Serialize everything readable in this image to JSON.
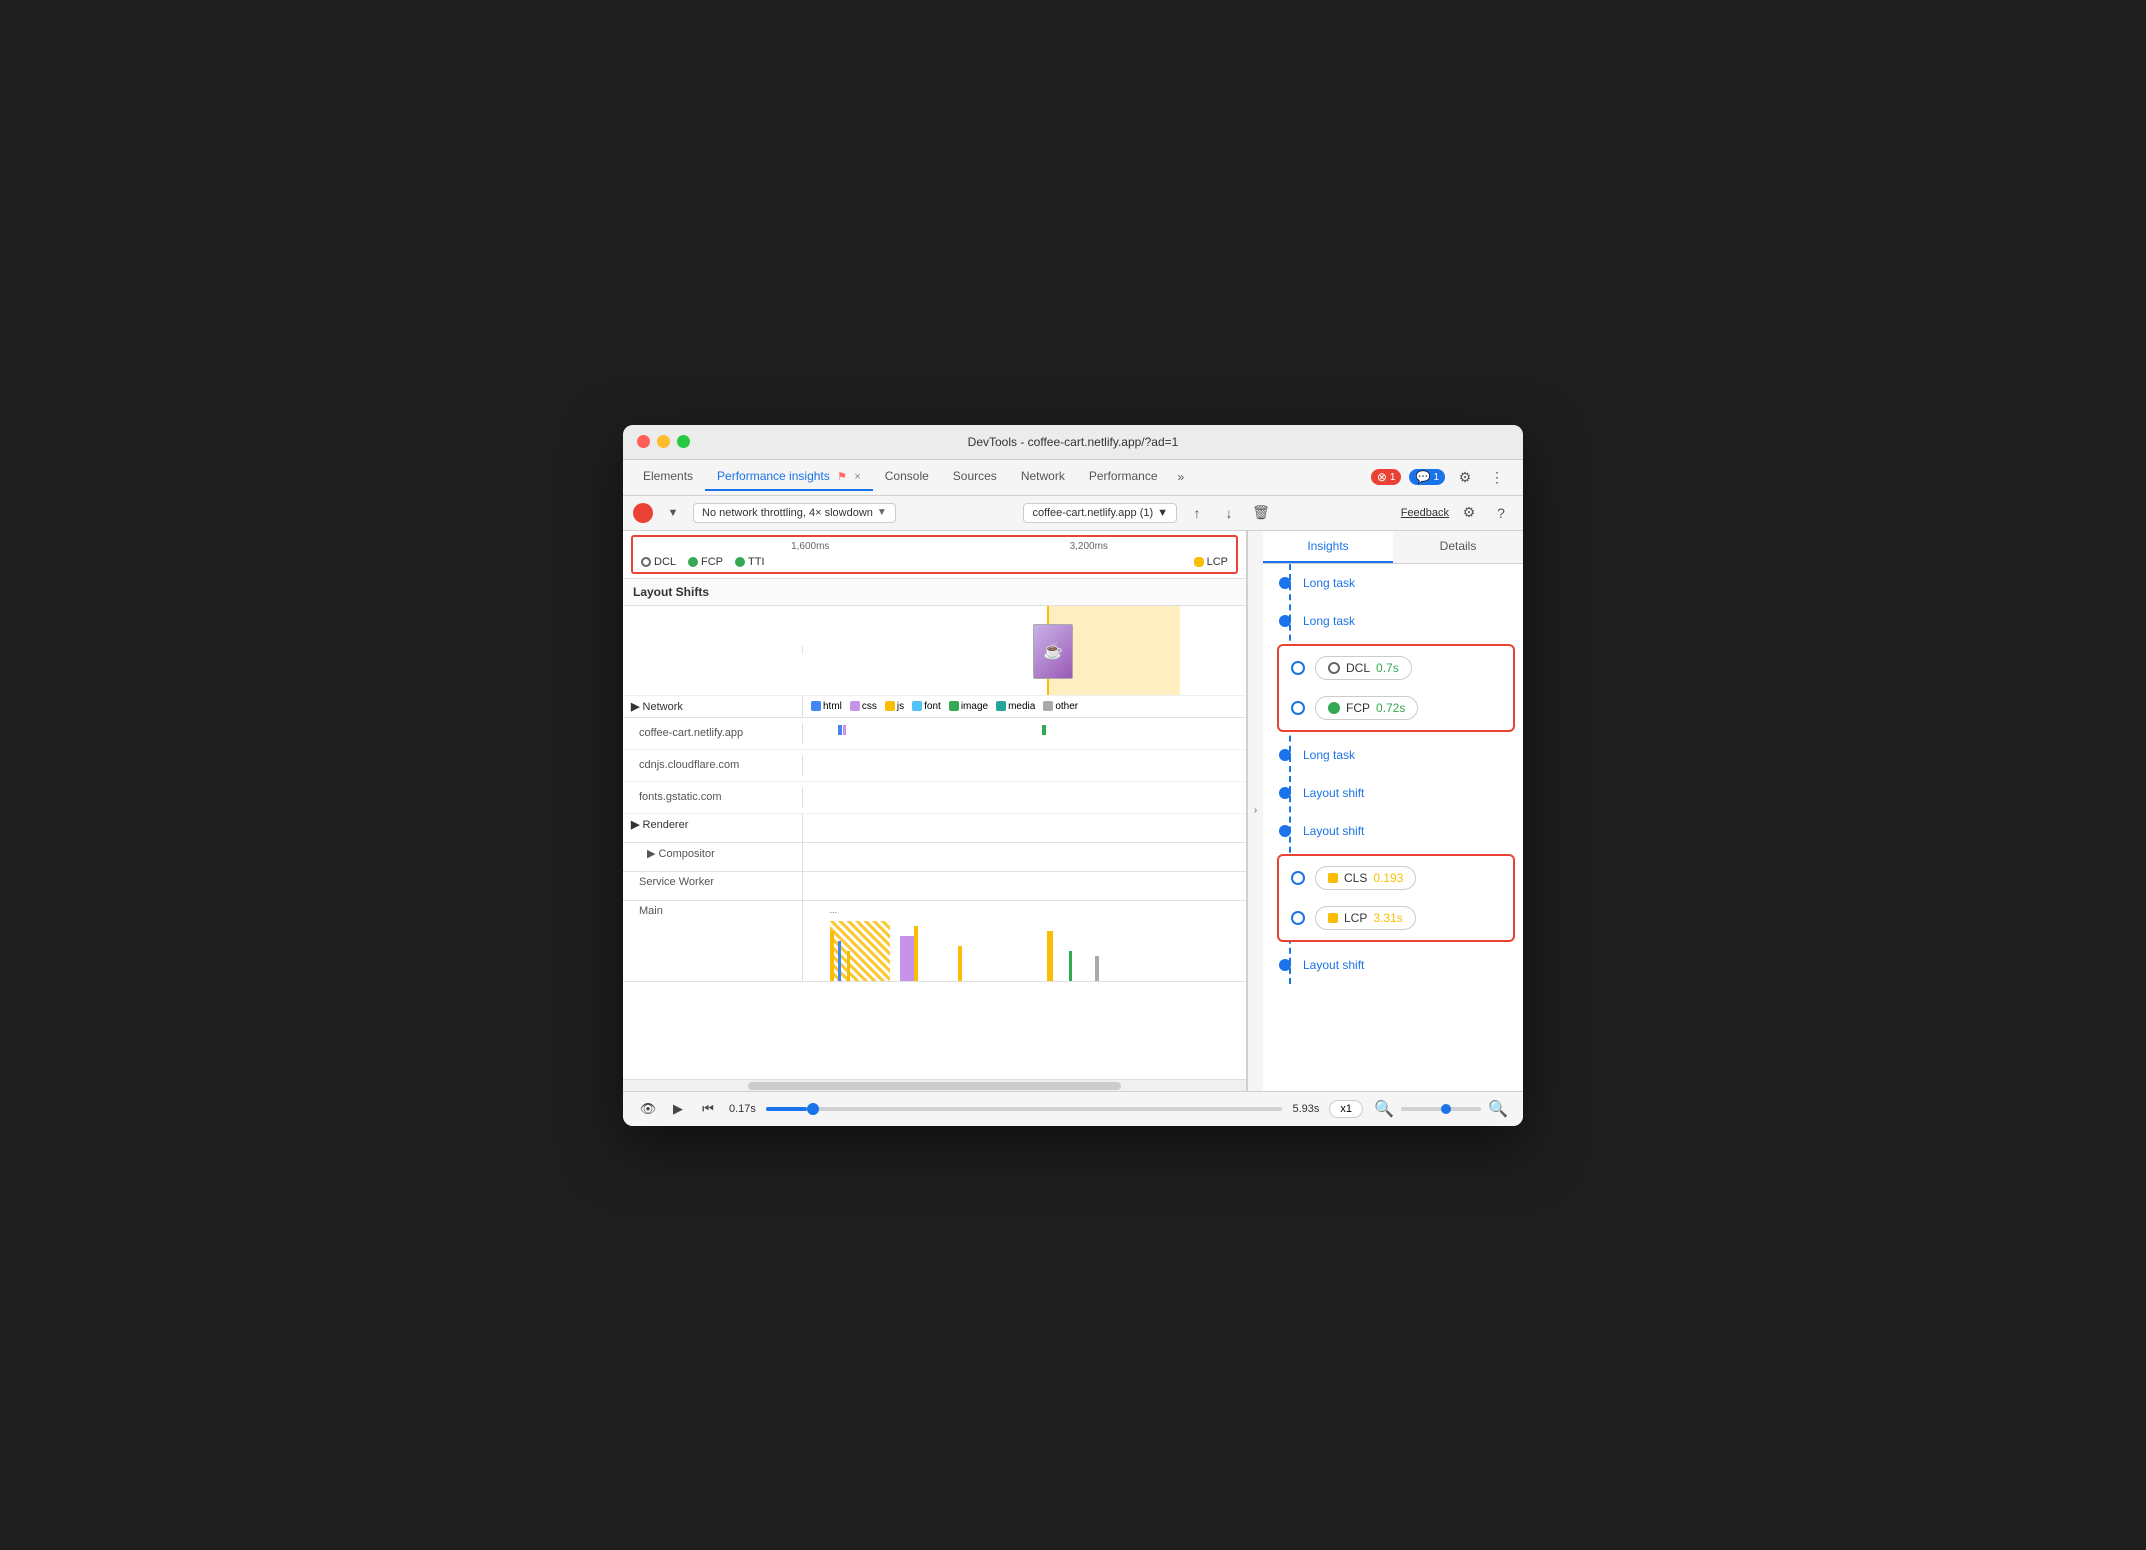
{
  "window": {
    "title": "DevTools - coffee-cart.netlify.app/?ad=1"
  },
  "tabs": {
    "items": [
      {
        "label": "Elements",
        "active": false
      },
      {
        "label": "Performance insights",
        "active": true
      },
      {
        "label": "Console",
        "active": false
      },
      {
        "label": "Sources",
        "active": false
      },
      {
        "label": "Network",
        "active": false
      },
      {
        "label": "Performance",
        "active": false
      }
    ],
    "more_label": "»",
    "error_count": "1",
    "message_count": "1"
  },
  "toolbar": {
    "throttling": "No network throttling, 4× slowdown",
    "url": "coffee-cart.netlify.app (1)",
    "feedback": "Feedback"
  },
  "timeline": {
    "time_labels": [
      "1,600ms",
      "3,200ms"
    ],
    "markers": {
      "dcl": "DCL",
      "fcp": "FCP",
      "tti": "TTI",
      "lcp": "LCP"
    },
    "sections": [
      {
        "label": "Layout Shifts"
      },
      {
        "label": "Network"
      },
      {
        "label": "Renderer"
      },
      {
        "label": "Compositor"
      },
      {
        "label": "Service Worker"
      },
      {
        "label": "Main"
      }
    ],
    "network_legend": [
      "html",
      "css",
      "js",
      "font",
      "image",
      "media",
      "other"
    ],
    "network_colors": {
      "html": "#4285f4",
      "css": "#c792ea",
      "js": "#fbbc04",
      "font": "#4fc3f7",
      "image": "#34a853",
      "media": "#26a69a",
      "other": "#aaa"
    },
    "network_hosts": [
      "coffee-cart.netlify.app",
      "cdnjs.cloudflare.com",
      "fonts.gstatic.com"
    ],
    "time_start": "0.17s",
    "time_end": "5.93s"
  },
  "insights": {
    "tab_insights": "Insights",
    "tab_details": "Details",
    "items": [
      {
        "type": "link",
        "label": "Long task"
      },
      {
        "type": "link",
        "label": "Long task"
      },
      {
        "type": "metric",
        "key": "DCL",
        "value": "0.7s",
        "color": "empty"
      },
      {
        "type": "metric",
        "key": "FCP",
        "value": "0.72s",
        "color": "green"
      },
      {
        "type": "link",
        "label": "Long task"
      },
      {
        "type": "link",
        "label": "Layout shift"
      },
      {
        "type": "link",
        "label": "Layout shift"
      },
      {
        "type": "metric",
        "key": "CLS",
        "value": "0.193",
        "color": "orange",
        "bad": true
      },
      {
        "type": "metric",
        "key": "LCP",
        "value": "3.31s",
        "color": "orange",
        "bad": true
      },
      {
        "type": "link",
        "label": "Layout shift"
      }
    ]
  },
  "bottom_bar": {
    "time_start": "0.17s",
    "time_end": "5.93s",
    "speed": "x1"
  }
}
